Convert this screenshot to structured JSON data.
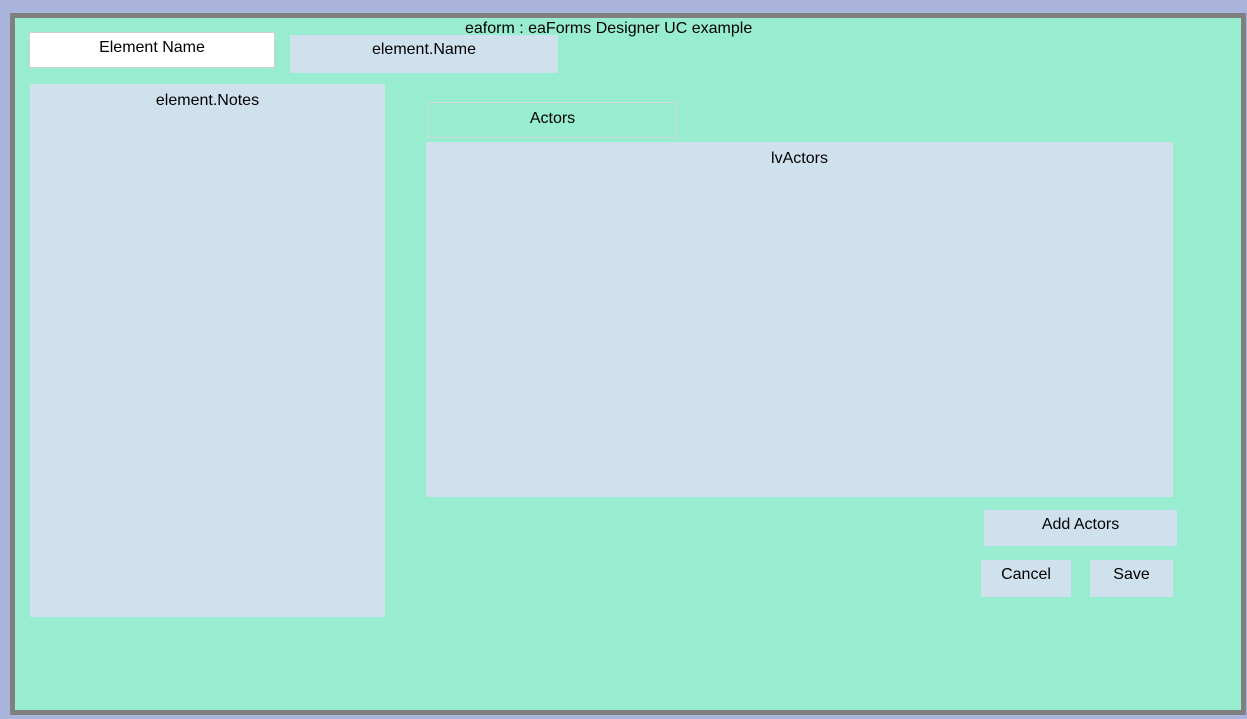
{
  "form": {
    "title": "eaform : eaForms Designer UC example"
  },
  "fields": {
    "element_name_label": "Element Name",
    "element_name_value": "element.Name",
    "element_notes": "element.Notes",
    "actors_label": "Actors",
    "actors_list": "lvActors"
  },
  "buttons": {
    "add_actors": "Add Actors",
    "cancel": "Cancel",
    "save": "Save"
  },
  "colors": {
    "background": "#98ecd0",
    "field": "#d0e1ee",
    "frame": "#808080",
    "outer": "#aab4da"
  }
}
